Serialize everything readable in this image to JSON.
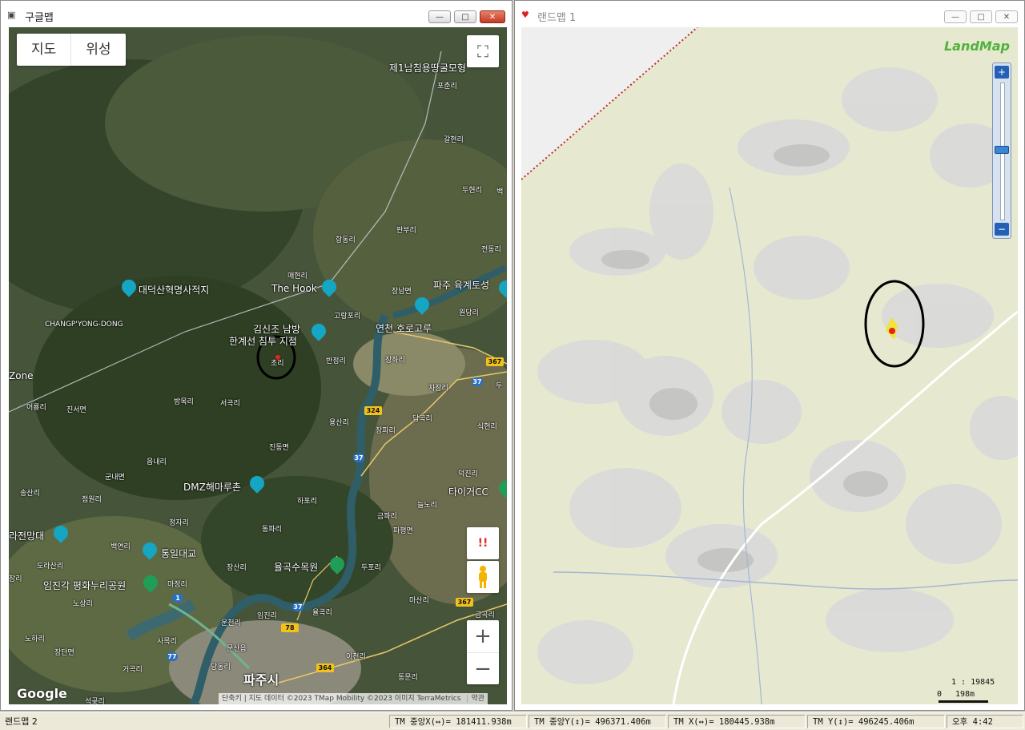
{
  "left_window": {
    "title": "구글맵",
    "map_type_buttons": [
      "지도",
      "위성"
    ],
    "labels": [
      {
        "t": "제1남침용땅굴모형",
        "c": "big"
      },
      {
        "t": "포춘리",
        "c": ""
      },
      {
        "t": "갈현리",
        "c": ""
      },
      {
        "t": "두현리",
        "c": ""
      },
      {
        "t": "백",
        "c": ""
      },
      {
        "t": "판부리",
        "c": ""
      },
      {
        "t": "항동리",
        "c": ""
      },
      {
        "t": "전동리",
        "c": ""
      },
      {
        "t": "매현리",
        "c": ""
      },
      {
        "t": "대덕산혁명사적지",
        "c": "big"
      },
      {
        "t": "The Hook",
        "c": "big"
      },
      {
        "t": "장남면",
        "c": ""
      },
      {
        "t": "파주 육계토성",
        "c": "big"
      },
      {
        "t": "원당리",
        "c": ""
      },
      {
        "t": "고랑포리",
        "c": ""
      },
      {
        "t": "CHANGP'YONG-DONG",
        "c": ""
      },
      {
        "t": "김신조 남방",
        "c": "big"
      },
      {
        "t": "한계선 침투 지점",
        "c": "big"
      },
      {
        "t": "연천 호로고루",
        "c": "big"
      },
      {
        "t": "초리",
        "c": ""
      },
      {
        "t": "반정리",
        "c": ""
      },
      {
        "t": "장좌리",
        "c": ""
      },
      {
        "t": "Zone",
        "c": "big"
      },
      {
        "t": "자장리",
        "c": ""
      },
      {
        "t": "두",
        "c": ""
      },
      {
        "t": "어룡리",
        "c": ""
      },
      {
        "t": "진서면",
        "c": ""
      },
      {
        "t": "방목리",
        "c": ""
      },
      {
        "t": "서곡리",
        "c": ""
      },
      {
        "t": "답곡리",
        "c": ""
      },
      {
        "t": "용산리",
        "c": ""
      },
      {
        "t": "식현리",
        "c": ""
      },
      {
        "t": "장파리",
        "c": ""
      },
      {
        "t": "진동면",
        "c": ""
      },
      {
        "t": "읍내리",
        "c": ""
      },
      {
        "t": "군내면",
        "c": ""
      },
      {
        "t": "덕진리",
        "c": ""
      },
      {
        "t": "송산리",
        "c": ""
      },
      {
        "t": "DMZ해마루촌",
        "c": "big"
      },
      {
        "t": "하포리",
        "c": ""
      },
      {
        "t": "타이거CC",
        "c": "big"
      },
      {
        "t": "점원리",
        "c": ""
      },
      {
        "t": "늘노리",
        "c": ""
      },
      {
        "t": "금파리",
        "c": ""
      },
      {
        "t": "정자리",
        "c": ""
      },
      {
        "t": "파평면",
        "c": ""
      },
      {
        "t": "동파리",
        "c": ""
      },
      {
        "t": "라전망대",
        "c": "big"
      },
      {
        "t": "백연리",
        "c": ""
      },
      {
        "t": "통일대교",
        "c": "big"
      },
      {
        "t": "도라산리",
        "c": ""
      },
      {
        "t": "장산리",
        "c": ""
      },
      {
        "t": "율곡수목원",
        "c": "big"
      },
      {
        "t": "두포리",
        "c": ""
      },
      {
        "t": "장리",
        "c": ""
      },
      {
        "t": "마정리",
        "c": ""
      },
      {
        "t": "임진각 평화누리공원",
        "c": "big"
      },
      {
        "t": "마산리",
        "c": ""
      },
      {
        "t": "노상리",
        "c": ""
      },
      {
        "t": "임진리",
        "c": ""
      },
      {
        "t": "율곡리",
        "c": ""
      },
      {
        "t": "금곡리",
        "c": ""
      },
      {
        "t": "운천리",
        "c": ""
      },
      {
        "t": "노하리",
        "c": ""
      },
      {
        "t": "사목리",
        "c": ""
      },
      {
        "t": "문산읍",
        "c": ""
      },
      {
        "t": "장단면",
        "c": ""
      },
      {
        "t": "이천리",
        "c": ""
      },
      {
        "t": "거곡리",
        "c": ""
      },
      {
        "t": "당동리",
        "c": ""
      },
      {
        "t": "동문리",
        "c": ""
      },
      {
        "t": "파주시",
        "c": "xl"
      },
      {
        "t": "석곶리",
        "c": ""
      }
    ],
    "routes": [
      "367",
      "37",
      "324",
      "37",
      "367",
      "1",
      "37",
      "78",
      "77",
      "364"
    ],
    "attribution": "단축키 | 지도 데이터 ©2023 TMap Mobility ©2023 이미지 TerraMetrics",
    "terms": "약관",
    "google_logo": "Google",
    "controls": {
      "fullscreen": "⛶",
      "alert": "!!",
      "zoom_in": "+",
      "zoom_out": "−"
    }
  },
  "right_window": {
    "title": "랜드맵 1",
    "logo": "LandMap",
    "scale_ratio": "1 : 19845",
    "scale_zero": "0",
    "scale_dist": "198m",
    "zoom_in": "+",
    "zoom_out": "−"
  },
  "status": {
    "left": "랜드맵 2",
    "tm_center_x": "TM 중앙X(↔)= 181411.938m",
    "tm_center_y": "TM 중앙Y(↕)= 496371.406m",
    "tm_x": "TM X(↔)= 180445.938m",
    "tm_y": "TM Y(↕)= 496245.406m",
    "time": "오후 4:42"
  },
  "window_buttons": {
    "min": "—",
    "max": "□",
    "close": "✕"
  },
  "colors": {
    "satellite": "#3b4a2c",
    "landmap_bg": "#e9ead5",
    "poi_blue": "#15a6c4",
    "route_yellow": "#f2c21b",
    "marker_red": "#e0261e",
    "landmap_logo": "#4fb23c"
  }
}
